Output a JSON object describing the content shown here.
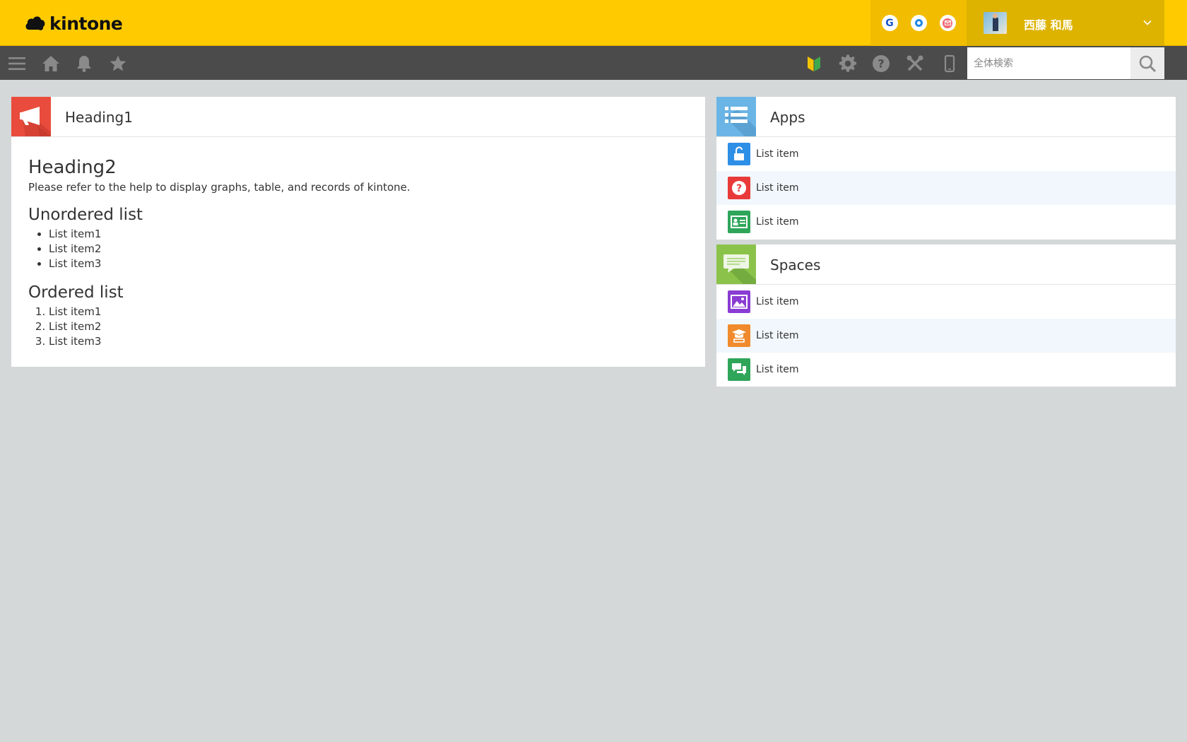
{
  "header": {
    "logo_text": "kintone",
    "services": [
      {
        "name": "google-icon",
        "letter": "G"
      },
      {
        "name": "office-icon"
      },
      {
        "name": "mail-icon"
      }
    ],
    "user_name": "西藤 和馬"
  },
  "toolbar": {
    "search_placeholder": "全体検索"
  },
  "main": {
    "heading1": "Heading1",
    "heading2": "Heading2",
    "help_text": "Please refer to the help to display graphs, table, and records of kintone.",
    "unordered_title": "Unordered list",
    "unordered_items": [
      "List item1",
      "List item2",
      "List item3"
    ],
    "ordered_title": "Ordered list",
    "ordered_items": [
      "List item1",
      "List item2",
      "List item3"
    ]
  },
  "apps": {
    "title": "Apps",
    "items": [
      {
        "label": "List item",
        "icon": "lock-icon",
        "color": "#2e8fe6"
      },
      {
        "label": "List item",
        "icon": "question-icon",
        "color": "#e93a3a"
      },
      {
        "label": "List item",
        "icon": "id-card-icon",
        "color": "#2fa55a"
      }
    ]
  },
  "spaces": {
    "title": "Spaces",
    "items": [
      {
        "label": "List item",
        "icon": "image-icon",
        "color": "#8a3cd3"
      },
      {
        "label": "List item",
        "icon": "graduation-icon",
        "color": "#f08a2c"
      },
      {
        "label": "List item",
        "icon": "chat-icon",
        "color": "#2fa55a"
      }
    ]
  },
  "colors": {
    "header_yellow": "#ffcb00",
    "toolbar_gray": "#4b4b4b",
    "background": "#d4d8d9"
  }
}
